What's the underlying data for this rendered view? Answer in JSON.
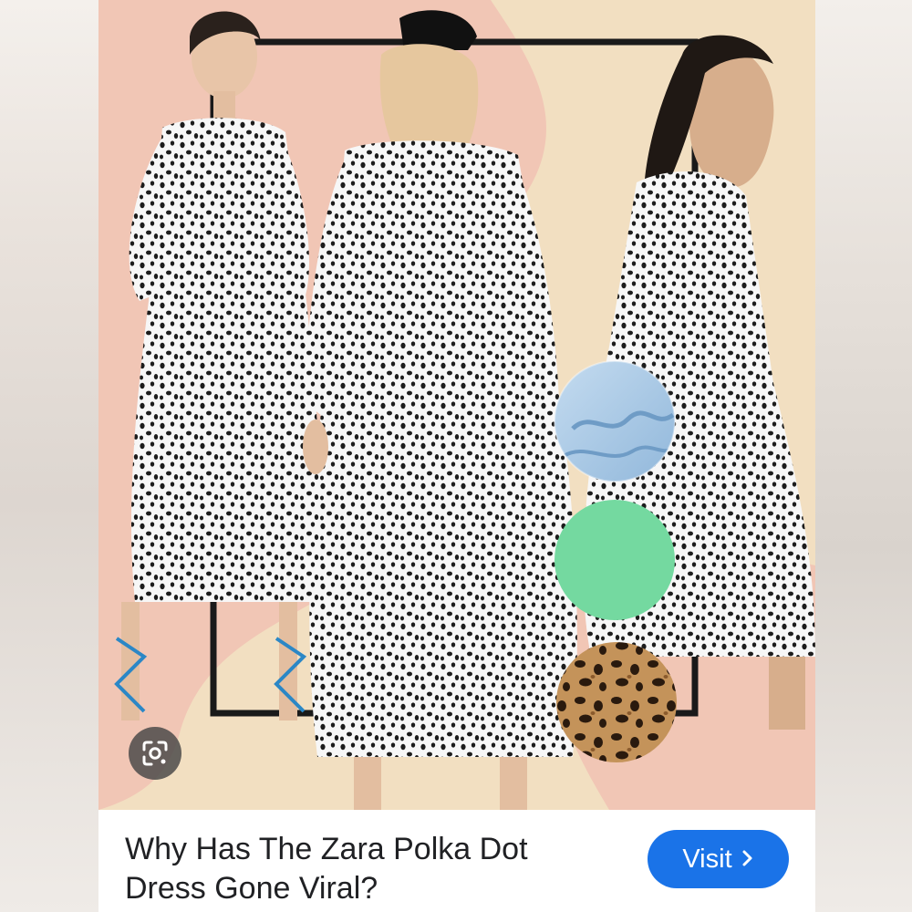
{
  "result": {
    "title_line1": "Why Has The Zara Polka Dot",
    "title_line2": "Dress Gone Viral?",
    "visit_label": "Visit",
    "visit_icon": "chevron-right-icon",
    "lens_icon": "google-lens-icon"
  },
  "image": {
    "subject": "three-models-polka-dot-dress",
    "swatches": [
      "denim-blue",
      "mint-green",
      "leopard-print"
    ],
    "colors": {
      "background": "#f2dfc1",
      "blob": "#f0c4b4",
      "frame": "#1a1a1a",
      "dress": "#f7f7f7",
      "dot": "#1c1c1c",
      "swatch_denim": "#a9c9e6",
      "swatch_mint": "#74d9a0",
      "swatch_leopard": "#b8864c"
    }
  },
  "theme": {
    "accent": "#1a73e8",
    "text": "#202124"
  }
}
